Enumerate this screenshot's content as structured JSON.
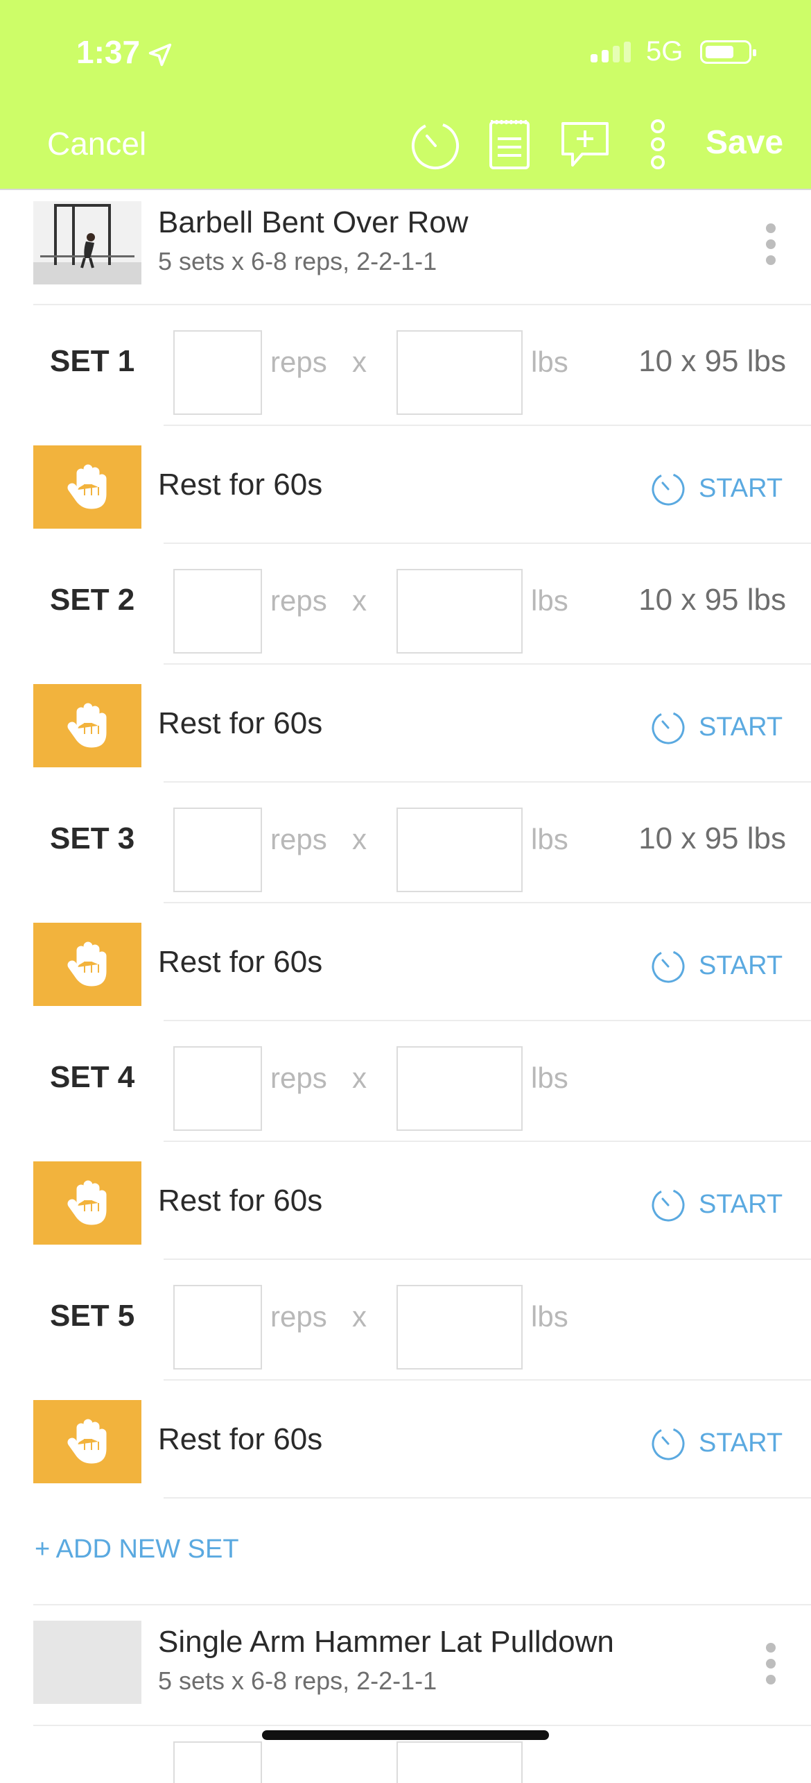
{
  "status_bar": {
    "time": "1:37",
    "network": "5G"
  },
  "header": {
    "cancel_label": "Cancel",
    "save_label": "Save",
    "icons": [
      "timer-icon",
      "notes-icon",
      "add-comment-icon",
      "more-vertical-icon"
    ]
  },
  "exercises": [
    {
      "title": "Barbell Bent Over Row",
      "subtitle": "5 sets x 6-8 reps, 2-2-1-1",
      "sets": [
        {
          "label": "SET 1",
          "reps_unit": "reps",
          "x": "x",
          "weight_unit": "lbs",
          "previous": "10 x 95 lbs",
          "rest": "Rest for 60s",
          "start": "START"
        },
        {
          "label": "SET 2",
          "reps_unit": "reps",
          "x": "x",
          "weight_unit": "lbs",
          "previous": "10 x 95 lbs",
          "rest": "Rest for 60s",
          "start": "START"
        },
        {
          "label": "SET 3",
          "reps_unit": "reps",
          "x": "x",
          "weight_unit": "lbs",
          "previous": "10 x 95 lbs",
          "rest": "Rest for 60s",
          "start": "START"
        },
        {
          "label": "SET 4",
          "reps_unit": "reps",
          "x": "x",
          "weight_unit": "lbs",
          "previous": "",
          "rest": "Rest for 60s",
          "start": "START"
        },
        {
          "label": "SET 5",
          "reps_unit": "reps",
          "x": "x",
          "weight_unit": "lbs",
          "previous": "",
          "rest": "Rest for 60s",
          "start": "START"
        }
      ],
      "add_set_label": "+ ADD NEW SET"
    },
    {
      "title": "Single Arm Hammer Lat Pulldown",
      "subtitle": "5 sets x 6-8 reps, 2-2-1-1"
    }
  ],
  "colors": {
    "header_bg": "#cdfd68",
    "rest_bg": "#f2b33d",
    "accent_blue": "#5aa9e0"
  }
}
